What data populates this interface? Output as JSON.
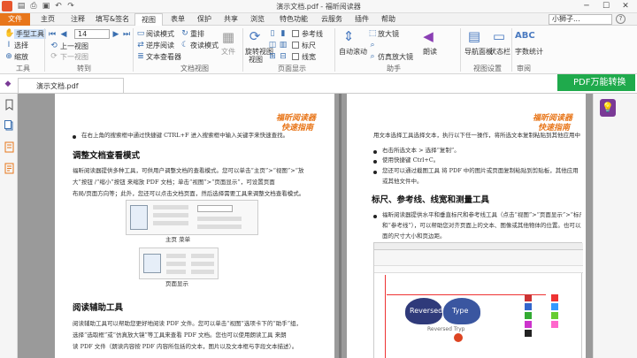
{
  "window": {
    "title": "演示文档.pdf - 福昕阅读器"
  },
  "tabs": [
    {
      "label": "文件"
    },
    {
      "label": "主页"
    },
    {
      "label": "注释"
    },
    {
      "label": "填写&签名"
    },
    {
      "label": "视图"
    },
    {
      "label": "表单"
    },
    {
      "label": "保护"
    },
    {
      "label": "共享"
    },
    {
      "label": "浏览"
    },
    {
      "label": "特色功能"
    },
    {
      "label": "云服务"
    },
    {
      "label": "插件"
    },
    {
      "label": "帮助"
    }
  ],
  "user": {
    "name": "小狮子..."
  },
  "ribbon": {
    "tools": {
      "hand": "手型工具",
      "select": "选择",
      "zoom": "缩放",
      "label": "工具"
    },
    "goto": {
      "page_value": "14",
      "prev": "上一视图",
      "next": "下一视图",
      "label": "转到"
    },
    "docview": {
      "reading": "阅读模式",
      "reverse": "逆序阅读",
      "text_viewer": "文本查看器",
      "swap": "重排",
      "theater": "夜读模式",
      "file_nav": "文件",
      "label": "文档视图"
    },
    "pageview": {
      "rotate": "旋转视图",
      "rotate2": "视图",
      "ref": "参考线",
      "ruler": "标尺",
      "grid": "线宽",
      "label": "页面显示"
    },
    "assist": {
      "autoscroll": "自动滚动",
      "magnify": "放大镜",
      "read": "朗读",
      "loupe": "仿真放大镜",
      "label": "助手"
    },
    "viewset": {
      "nav": "导航面板",
      "status": "状态栏",
      "label": "视图设置"
    },
    "review": {
      "word_count": "字数统计",
      "label": "审阅"
    }
  },
  "doc": {
    "tab_label": "演示文档.pdf",
    "pdf_convert": "PDF万能转换"
  },
  "left_page": {
    "header1": "福昕阅读器",
    "header2": "快速指南",
    "bullet1": "在右上角的搜索框中通过快捷键 CTRL+F 进入搜索框中输入关键字来快速查找。",
    "title1": "调整文档查看模式",
    "para1a": "福昕阅读器提供多种工具，可供用户调整文档的查看模式。您可以单击“主页”>“视图”>“放",
    "para1b": "大”按钮   /“缩小”按钮   来缩放 PDF 文档；单击“视图”>“页面显示”，可设置页面",
    "para1c": "布局/页面方向等；此外，您还可以点击文档页面，然后选择需要工具来调整文档查看模式。",
    "fig1_cap": "主页 菜单",
    "fig2_cap": "页面显示",
    "title2": "阅读辅助工具",
    "para2a": "阅读辅助工具可以帮助您更好地阅读 PDF 文件。您可以单击“视图”选项卡下的“助手”组，",
    "para2b": "选择“选取框”或“仿真放大镜”等工具来查看 PDF 文档。您也可以使用朗读工具   来朗",
    "para2c": "读 PDF 文件（朗读内容按 PDF 内容所包括的文本，图片以及文本框与字段文本描述）。"
  },
  "right_page": {
    "header1": "福昕阅读器",
    "header2": "快速指南",
    "para0": "用文本选择工具选择文本，执行以下任一操作，将所选文本复制粘贴到其他应用中：",
    "bullet1": "右击所选文本 > 选择“复制”。",
    "bullet2": "使用快捷键 Ctrl+C。",
    "bullet3a": "您还可以通过截图工具    将 PDF 中的图片或页面复制粘贴到剪贴板，其他应用",
    "bullet3b": "或其他文件中。",
    "title1": "标尺、参考线、线宽和测量工具",
    "para1a": "福昕阅读器提供水平和垂直标尺和参考线工具（点击“视图”>“页面显示”>“标尺”",
    "para1b": "和“参考线”），可以帮助您对齐页面上的文本、图像或其他物体的位置。也可以显示页",
    "para1c": "面的尺寸大小和页边距。",
    "shot_title": "Reversed Tryp",
    "shot_label_a": "Reversed",
    "shot_label_b": "Type"
  }
}
